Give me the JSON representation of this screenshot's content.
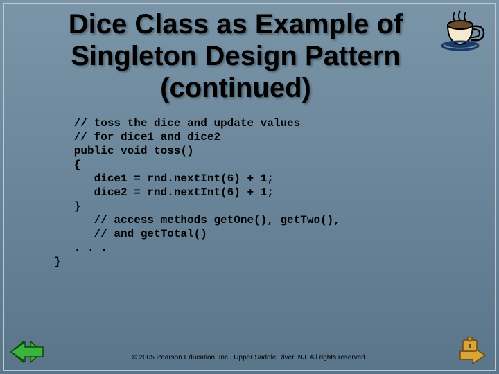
{
  "title": "Dice Class as Example of Singleton Design Pattern (continued)",
  "code": "   // toss the dice and update values\n   // for dice1 and dice2\n   public void toss()\n   {\n      dice1 = rnd.nextInt(6) + 1;\n      dice2 = rnd.nextInt(6) + 1;\n   }\n      // access methods getOne(), getTwo(),\n      // and getTotal()\n   . . .\n}",
  "copyright": "© 2005 Pearson Education, Inc., Upper Saddle River, NJ.  All rights reserved."
}
